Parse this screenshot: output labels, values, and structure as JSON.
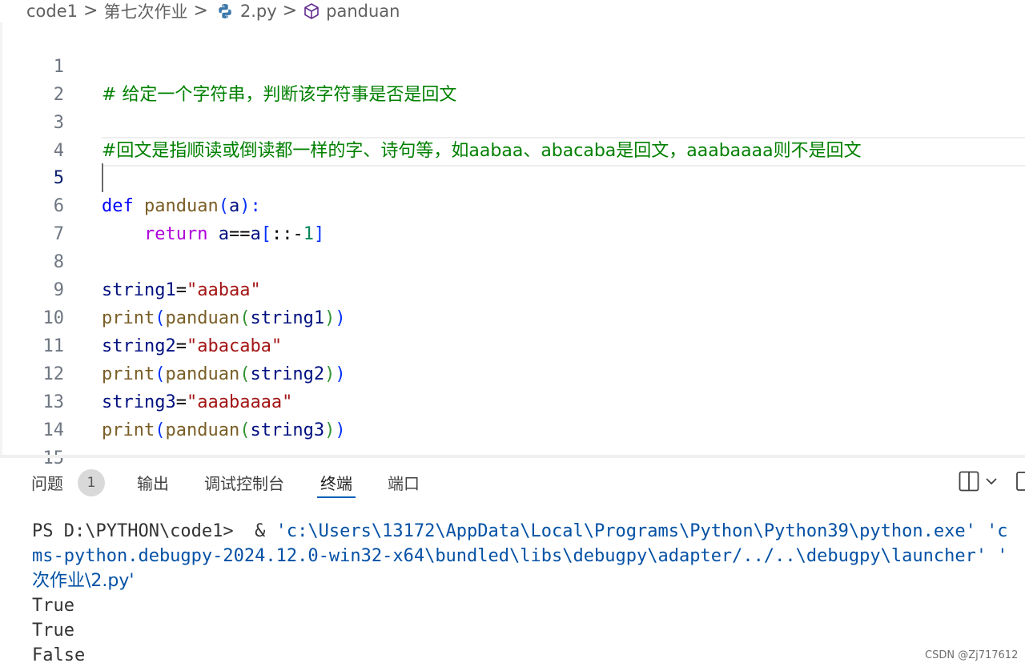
{
  "breadcrumb": {
    "items": [
      "code1",
      "第七次作业",
      "2.py",
      "panduan"
    ],
    "separator": ">"
  },
  "editor": {
    "active_line": 5,
    "line_numbers": [
      "1",
      "2",
      "3",
      "4",
      "5",
      "6",
      "7",
      "8",
      "9",
      "10",
      "11",
      "12",
      "13",
      "14",
      "15"
    ],
    "lines": {
      "l1": "# 给定一个字符串，判断该字符事是否是回文",
      "l3": "#回文是指顺读或倒读都一样的字、诗句等，如aabaa、abacaba是回文，aaabaaaa则不是回文",
      "l5": {
        "kw": "def",
        "name": "panduan",
        "open": "(",
        "param": "a",
        "close": "):"
      },
      "l6": {
        "kw": "return",
        "a": "a",
        "eq": "==",
        "a2": "a",
        "lb": "[",
        "slice": "::-",
        "num": "1",
        "rb": "]"
      },
      "l8": {
        "var": "string1",
        "eq": "=",
        "str": "\"aabaa\""
      },
      "l9": {
        "print": "print",
        "p1": "(",
        "fn": "panduan",
        "p2": "(",
        "arg": "string1",
        "p3": ")",
        "p4": ")"
      },
      "l10": {
        "var": "string2",
        "eq": "=",
        "str": "\"abacaba\""
      },
      "l11": {
        "print": "print",
        "p1": "(",
        "fn": "panduan",
        "p2": "(",
        "arg": "string2",
        "p3": ")",
        "p4": ")"
      },
      "l12": {
        "var": "string3",
        "eq": "=",
        "str": "\"aaabaaaa\""
      },
      "l13": {
        "print": "print",
        "p1": "(",
        "fn": "panduan",
        "p2": "(",
        "arg": "string3",
        "p3": ")",
        "p4": ")"
      }
    }
  },
  "panel": {
    "tabs": [
      "问题",
      "输出",
      "调试控制台",
      "终端",
      "端口"
    ],
    "active_tab": "终端",
    "problems_count": "1"
  },
  "terminal": {
    "prompt": "PS D:\\PYTHON\\code1>  & ",
    "cmd1": "'c:\\Users\\13172\\AppData\\Local\\Programs\\Python\\Python39\\python.exe' 'c",
    "cmd2": "ms-python.debugpy-2024.12.0-win32-x64\\bundled\\libs\\debugpy\\adapter/../..\\debugpy\\launcher' '",
    "cmd3": "次作业\\2.py'",
    "outputs": [
      "True",
      "True",
      "False"
    ]
  },
  "watermark": "CSDN @Zj717612",
  "colors": {
    "comment": "#008000",
    "keyword": "#af00db",
    "def": "#0000ff",
    "function": "#795e26",
    "variable": "#001080",
    "string": "#a31515",
    "number": "#098658",
    "terminal_string": "#0451a5",
    "active_tab_underline": "#005fb8"
  }
}
